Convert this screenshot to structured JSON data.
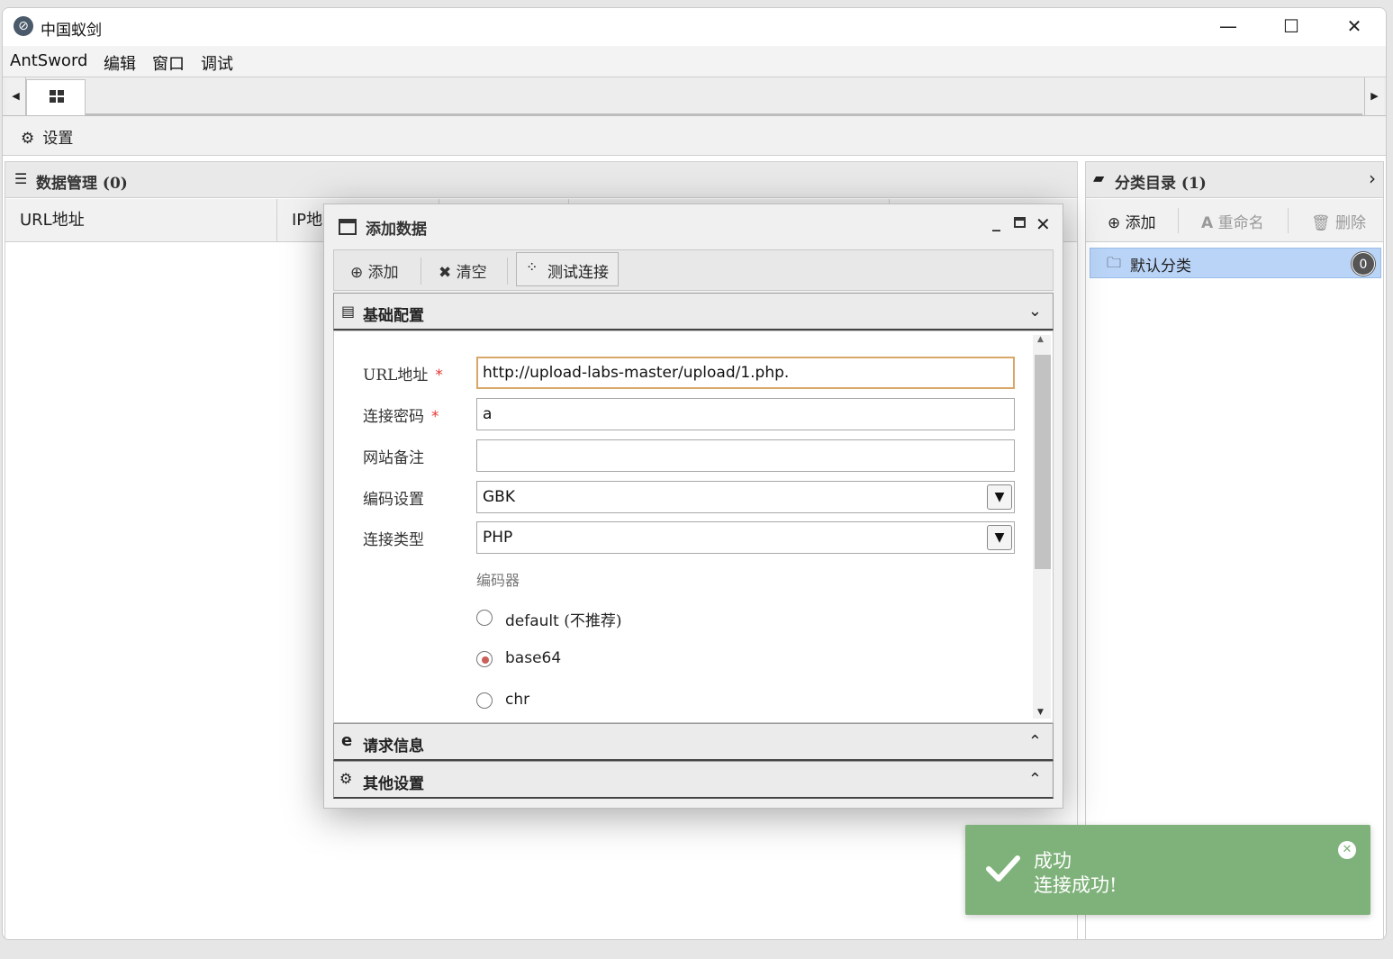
{
  "window": {
    "title": "中国蚁剑",
    "controls": {
      "minimize": "—",
      "maximize": "☐",
      "close": "✕"
    }
  },
  "menu": [
    "AntSword",
    "编辑",
    "窗口",
    "调试"
  ],
  "toolbar": {
    "settings_label": "设置"
  },
  "data_panel": {
    "title": "数据管理 (0)",
    "columns": [
      "URL地址",
      "IP地"
    ]
  },
  "category_panel": {
    "title": "分类目录 (1)",
    "buttons": {
      "add": "添加",
      "rename": "重命名",
      "delete": "删除"
    },
    "items": [
      {
        "label": "默认分类",
        "count": "0"
      }
    ]
  },
  "dialog": {
    "title": "添加数据",
    "toolbar": {
      "add": "添加",
      "clear": "清空",
      "test": "测试连接"
    },
    "sections": {
      "basic": "基础配置",
      "request": "请求信息",
      "other": "其他设置"
    },
    "form": {
      "url_label": "URL地址",
      "url_value": "http://upload-labs-master/upload/1.php.",
      "password_label": "连接密码",
      "password_value": "a",
      "note_label": "网站备注",
      "note_value": "",
      "encoding_label": "编码设置",
      "encoding_value": "GBK",
      "type_label": "连接类型",
      "type_value": "PHP",
      "encoder_label": "编码器",
      "encoders": [
        {
          "name": "default",
          "note": "(不推荐)",
          "selected": false
        },
        {
          "name": "base64",
          "note": "",
          "selected": true
        },
        {
          "name": "chr",
          "note": "",
          "selected": false
        }
      ],
      "required_mark": "*"
    }
  },
  "toast": {
    "title": "成功",
    "message": "连接成功!",
    "color": "#7fb27a"
  }
}
